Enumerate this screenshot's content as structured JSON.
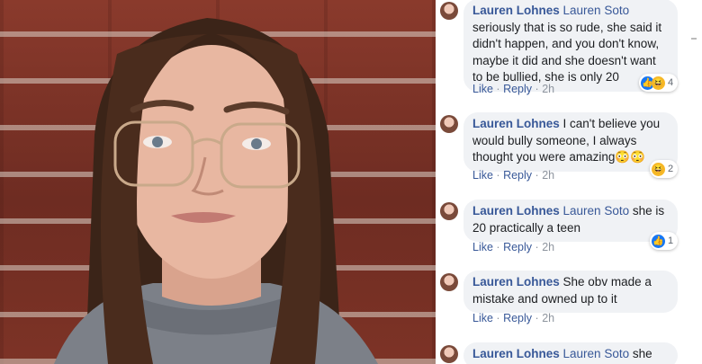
{
  "comments": [
    {
      "author": "Lauren Lohnes",
      "mention": "Lauren Soto",
      "text": "seriously that is so rude, she said it didn't happen, and you don't know, maybe it did and she doesn't want to be bullied, she is only 20",
      "like_label": "Like",
      "reply_label": "Reply",
      "time": "2h",
      "reaction_count": "4"
    },
    {
      "author": "Lauren Lohnes",
      "mention": "",
      "text": "I can't believe you would bully someone, I always thought you were amazing",
      "text_emoji": "😳😳",
      "like_label": "Like",
      "reply_label": "Reply",
      "time": "2h",
      "reaction_count": "2"
    },
    {
      "author": "Lauren Lohnes",
      "mention": "Lauren Soto",
      "text": "she is 20 practically a teen",
      "like_label": "Like",
      "reply_label": "Reply",
      "time": "2h",
      "reaction_count": "1"
    },
    {
      "author": "Lauren Lohnes",
      "mention": "",
      "text": "She obv made a mistake and owned up to it",
      "like_label": "Like",
      "reply_label": "Reply",
      "time": "2h"
    },
    {
      "author": "Lauren Lohnes",
      "mention": "Lauren Soto",
      "text": "she"
    }
  ],
  "separator": "·",
  "icons": {
    "like": "like-icon",
    "haha": "haha-icon"
  },
  "colors": {
    "link": "#385898",
    "bubble": "#f0f2f5",
    "like_blue": "#1877f2",
    "haha_yellow": "#f7b928"
  }
}
